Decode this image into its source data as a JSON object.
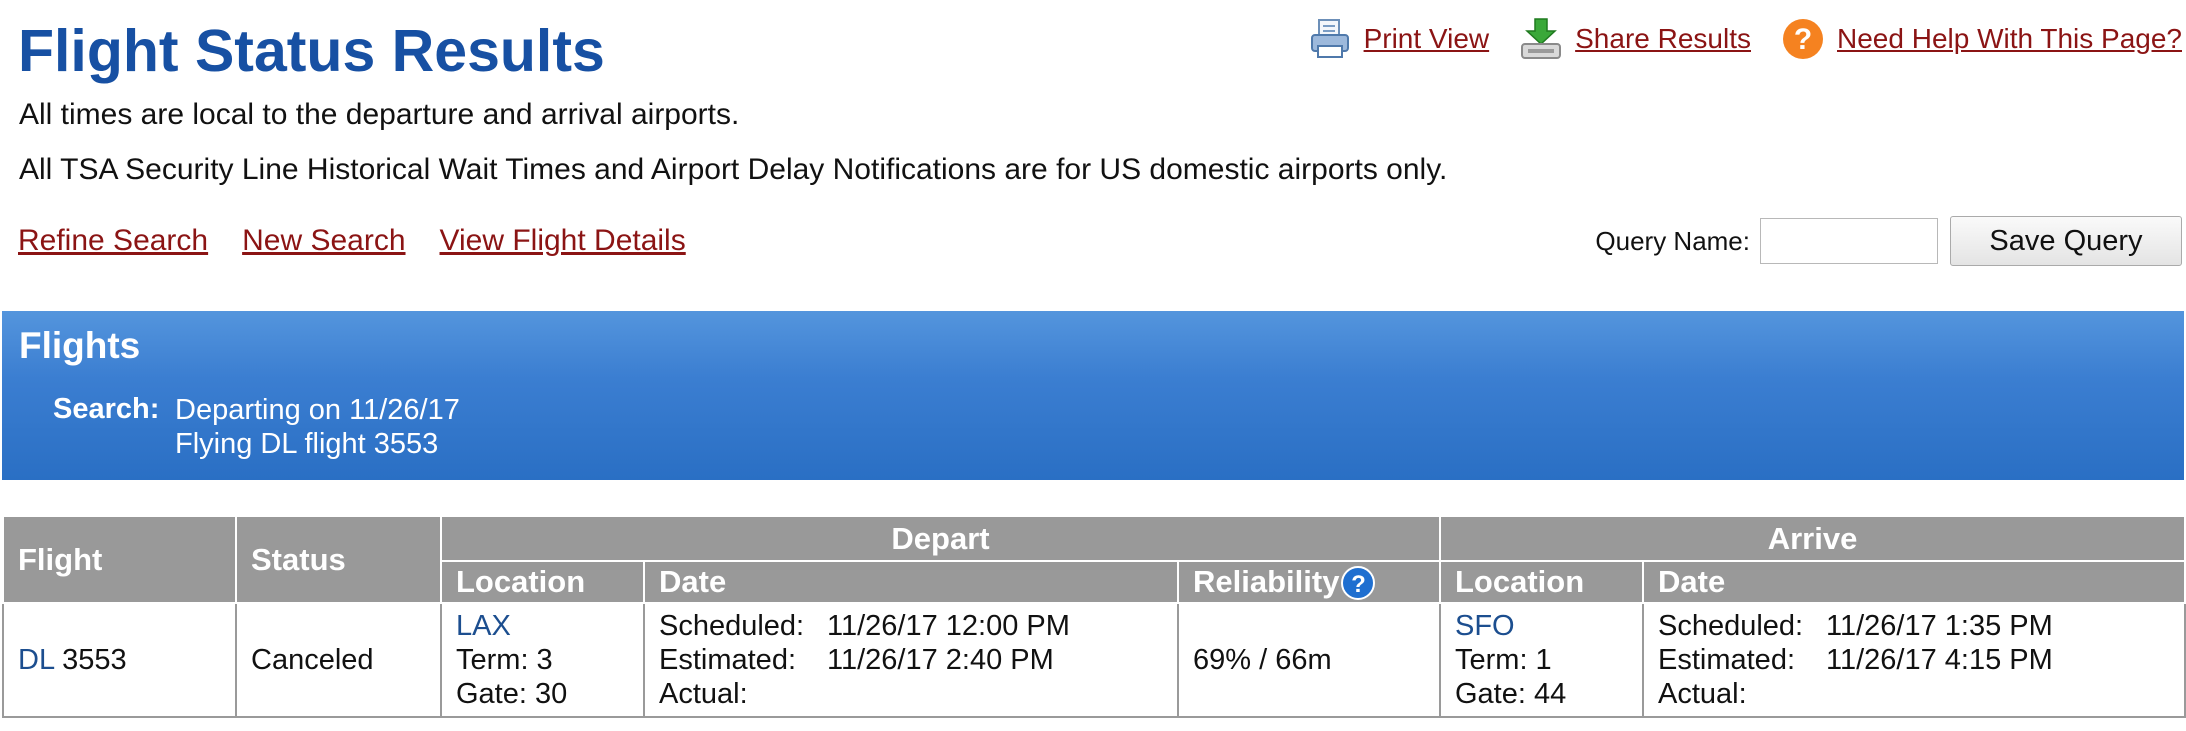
{
  "page": {
    "title": "Flight Status Results",
    "note1": "All times are local to the departure and arrival airports.",
    "note2": "All TSA Security Line Historical Wait Times and Airport Delay Notifications are for US domestic airports only."
  },
  "toplinks": {
    "print": "Print View",
    "share": "Share Results",
    "help": "Need Help With This Page?"
  },
  "nav": {
    "refine": "Refine Search",
    "new": "New Search",
    "details": "View Flight Details"
  },
  "query": {
    "label": "Query Name:",
    "value": "",
    "save": "Save Query"
  },
  "banner": {
    "title": "Flights",
    "search_label": "Search:",
    "line1": "Departing on 11/26/17",
    "line2": "Flying DL flight 3553"
  },
  "table": {
    "headers": {
      "flight": "Flight",
      "status": "Status",
      "depart": "Depart",
      "arrive": "Arrive",
      "location": "Location",
      "date": "Date",
      "reliability": "Reliability"
    },
    "row": {
      "airline": "DL",
      "number": "3553",
      "status": "Canceled",
      "depart": {
        "airport": "LAX",
        "term": "Term: 3",
        "gate": "Gate: 30",
        "sched_label": "Scheduled:",
        "sched": "11/26/17 12:00 PM",
        "est_label": "Estimated:",
        "est": "11/26/17 2:40 PM",
        "actual_label": "Actual:"
      },
      "reliability": "69% / 66m",
      "arrive": {
        "airport": "SFO",
        "term": "Term: 1",
        "gate": "Gate: 44",
        "sched_label": "Scheduled:",
        "sched": "11/26/17 1:35 PM",
        "est_label": "Estimated:",
        "est": "11/26/17 4:15 PM",
        "actual_label": "Actual:"
      }
    }
  },
  "icons": {
    "print": "printer-icon",
    "share": "download-tray-icon",
    "help": "help-question-icon",
    "info": "question-circle-icon"
  },
  "colors": {
    "title": "#1750a3",
    "link": "#8b1414",
    "banner": "#3b7ed1",
    "header": "#999999",
    "help": "#f58220"
  }
}
